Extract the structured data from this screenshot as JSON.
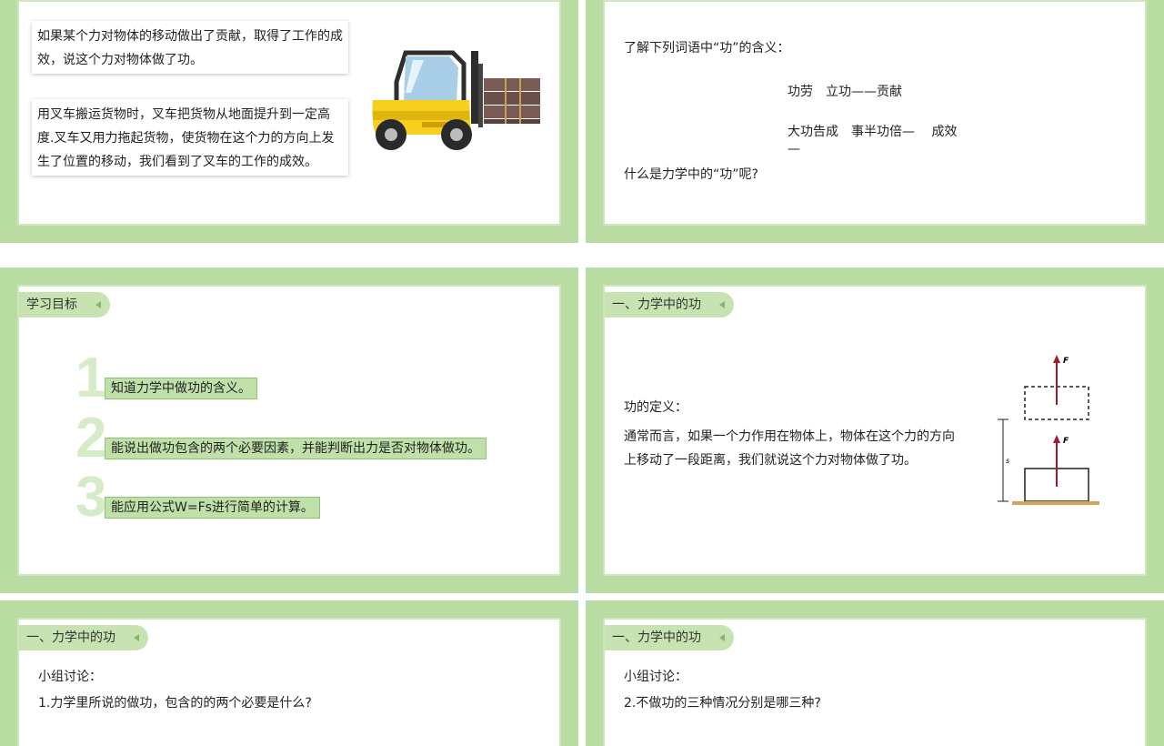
{
  "slide1": {
    "card1": "如果某个力对物体的移动做出了贡献，取得了工作的成效，说这个力对物体做了功。",
    "card2": "用叉车搬运货物时，叉车把货物从地面提升到一定高度.叉车又用力拖起货物，使货物在这个力的方向上发生了位置的移动，我们看到了叉车的工作的成效。"
  },
  "slide2": {
    "intro": "了解下列词语中“功”的含义：",
    "line1": "功劳　立功——贡献",
    "line2": "大功告成　事半功倍—　 成效",
    "line2_tail": "—",
    "question": "什么是力学中的“功”呢?"
  },
  "slide3": {
    "tag": "学习目标",
    "goals": [
      {
        "num": "1",
        "text": "知道力学中做功的含义。"
      },
      {
        "num": "2",
        "text": "能说出做功包含的两个必要因素，并能判断出力是否对物体做功。"
      },
      {
        "num": "3",
        "text": "能应用公式W=Fs进行简单的计算。"
      }
    ]
  },
  "slide4": {
    "tag": "一、力学中的功",
    "def_title": "功的定义：",
    "def_line1": "通常而言，如果一个力作用在物体上，物体在这个力的方向",
    "def_line2": "上移动了一段距离，我们就说这个力对物体做了功。",
    "diagram": {
      "force_label_top": "F",
      "force_label_bottom": "F",
      "distance_label": "s"
    }
  },
  "slide5": {
    "tag": "一、力学中的功",
    "title": "小组讨论：",
    "q": "1.力学里所说的做功，包含的的两个必要是什么?"
  },
  "slide6": {
    "tag": "一、力学中的功",
    "title": "小组讨论：",
    "q": "2.不做功的三种情况分别是哪三种?"
  },
  "colors": {
    "frame": "#b9dca3",
    "tag": "#c7e3b2",
    "goal_bar": "#bfe0a8",
    "goal_num": "#d6ebc7",
    "force_arrow": "#a01c2c"
  }
}
